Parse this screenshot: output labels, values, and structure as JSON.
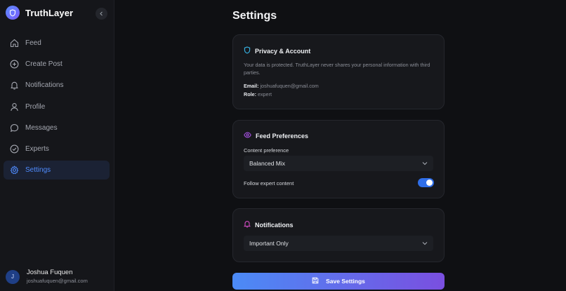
{
  "app": {
    "name": "TruthLayer"
  },
  "nav": {
    "items": [
      {
        "label": "Feed",
        "icon": "home-icon"
      },
      {
        "label": "Create Post",
        "icon": "plus-circle-icon"
      },
      {
        "label": "Notifications",
        "icon": "bell-icon"
      },
      {
        "label": "Profile",
        "icon": "user-icon"
      },
      {
        "label": "Messages",
        "icon": "chat-bubble-icon"
      },
      {
        "label": "Experts",
        "icon": "check-circle-icon"
      },
      {
        "label": "Settings",
        "icon": "gear-icon",
        "active": true
      }
    ]
  },
  "user": {
    "initial": "J",
    "name": "Joshua Fuquen",
    "email": "joshuafuquen@gmail.com"
  },
  "page": {
    "title": "Settings"
  },
  "privacy": {
    "title": "Privacy & Account",
    "description": "Your data is protected. TruthLayer never shares your personal information with third parties.",
    "email_label": "Email:",
    "email_value": "joshuafuquen@gmail.com",
    "role_label": "Role:",
    "role_value": "expert"
  },
  "feed": {
    "title": "Feed Preferences",
    "content_label": "Content preference",
    "content_value": "Balanced Mix",
    "follow_label": "Follow expert content",
    "follow_enabled": true
  },
  "notifications": {
    "title": "Notifications",
    "value": "Important Only"
  },
  "save": {
    "label": "Save Settings"
  },
  "colors": {
    "accent_blue": "#4f8cff",
    "privacy_icon": "#38b6e8",
    "feed_icon": "#b055f0",
    "notif_icon": "#e04fd0",
    "toggle_on": "#2f6ee8"
  }
}
